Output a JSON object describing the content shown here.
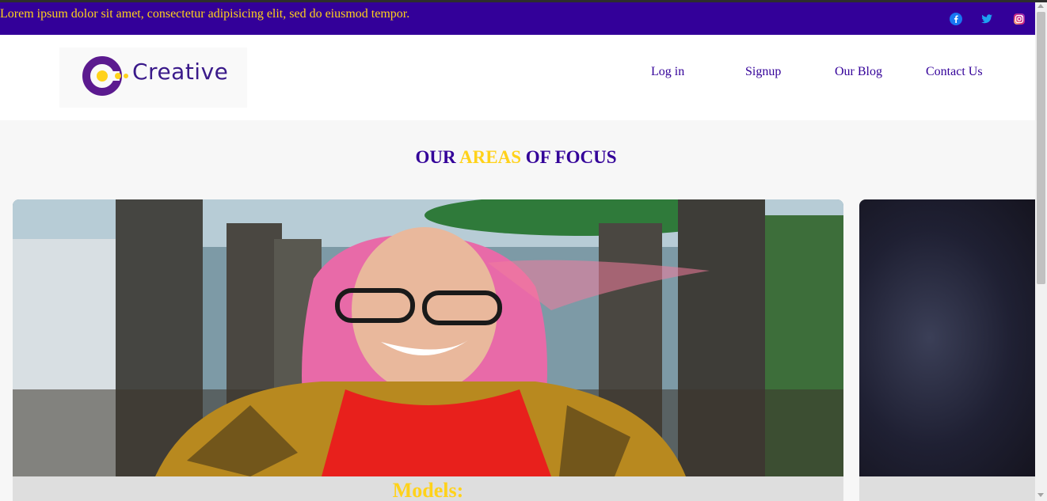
{
  "topbar": {
    "tagline": "Lorem ipsum dolor sit amet, consectetur adipisicing elit, sed do eiusmod tempor.",
    "social": [
      {
        "icon": "facebook-icon",
        "color": "#1877f2"
      },
      {
        "icon": "twitter-icon",
        "color": "#1da1f2"
      },
      {
        "icon": "instagram-icon",
        "color": "#e1306c"
      }
    ],
    "background": "#330099",
    "text_color": "#ffd21a"
  },
  "header": {
    "logo_text": "Creative",
    "nav": {
      "login": "Log in",
      "signup": "Signup",
      "blog": "Our Blog",
      "contact": "Contact Us"
    }
  },
  "focus": {
    "title_part1": "OUR",
    "title_accent": "AREAS",
    "title_part2": "OF FOCUS",
    "cards": [
      {
        "caption": "Models:"
      },
      {
        "caption": ""
      }
    ]
  },
  "colors": {
    "primary": "#330099",
    "accent": "#ffd21a"
  }
}
